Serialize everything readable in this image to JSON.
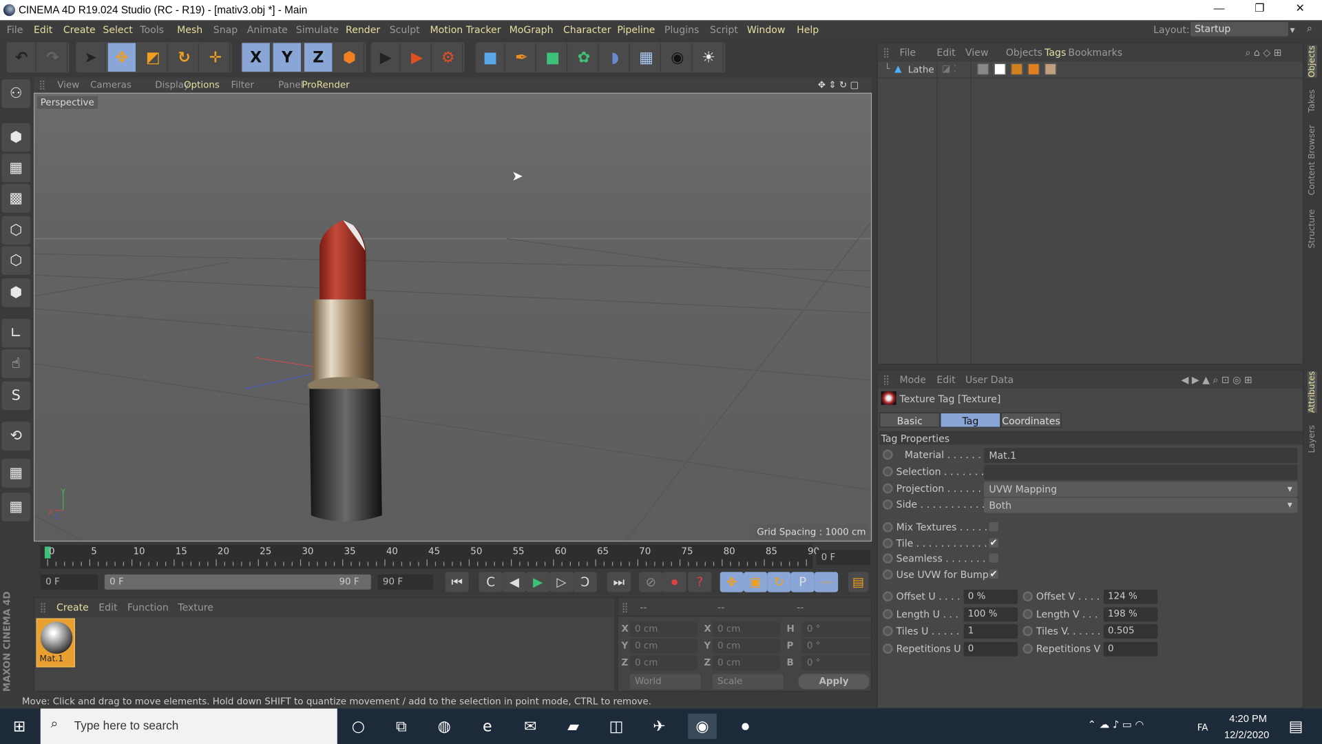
{
  "window": {
    "title": "CINEMA 4D R19.024 Studio (RC - R19) - [mativ3.obj *] - Main",
    "minimize": "—",
    "restore": "❐",
    "close": "✕"
  },
  "menubar": {
    "items": [
      {
        "label": "File",
        "style": "dim"
      },
      {
        "label": "Edit",
        "style": "hl"
      },
      {
        "label": "Create",
        "style": "hl"
      },
      {
        "label": "Select",
        "style": "hl"
      },
      {
        "label": "Tools",
        "style": "dim"
      },
      {
        "label": "Mesh",
        "style": "hl"
      },
      {
        "label": "Snap",
        "style": "dim"
      },
      {
        "label": "Animate",
        "style": "dim"
      },
      {
        "label": "Simulate",
        "style": "dim"
      },
      {
        "label": "Render",
        "style": "hl"
      },
      {
        "label": "Sculpt",
        "style": "dim"
      },
      {
        "label": "Motion Tracker",
        "style": "hl"
      },
      {
        "label": "MoGraph",
        "style": "hl"
      },
      {
        "label": "Character",
        "style": "hl"
      },
      {
        "label": "Pipeline",
        "style": "hl"
      },
      {
        "label": "Plugins",
        "style": "dim"
      },
      {
        "label": "Script",
        "style": "dim"
      },
      {
        "label": "Window",
        "style": "hl"
      },
      {
        "label": "Help",
        "style": "hl"
      }
    ],
    "layout_label": "Layout:",
    "layout_value": "Startup"
  },
  "toolbar": {
    "icons": [
      "undo-icon",
      "redo-icon",
      "live-selection-icon",
      "move-icon",
      "scale-icon",
      "rotate-icon",
      "last-tool-icon",
      "x-axis-icon",
      "y-axis-icon",
      "z-axis-icon",
      "coordinate-system-icon",
      "render-view-icon",
      "render-picture-viewer-icon",
      "render-settings-icon",
      "cube-icon",
      "pen-icon",
      "subdivision-icon",
      "cloner-icon",
      "bend-deformer-icon",
      "floor-icon",
      "camera-icon",
      "light-icon"
    ],
    "axis_labels": [
      "X",
      "Y",
      "Z"
    ]
  },
  "left_tools": [
    "make-editable-icon",
    "model-mode-icon",
    "texture-mode-icon",
    "workplane-mode-icon",
    "points-mode-icon",
    "edges-mode-icon",
    "polygons-mode-icon",
    "axis-mode-icon",
    "tweak-icon",
    "solo-icon",
    "snap-icon",
    "workplane-lock-icon",
    "workplane-rotate-icon"
  ],
  "viewport": {
    "menu": [
      {
        "label": "View",
        "style": "dim"
      },
      {
        "label": "Cameras",
        "style": "dim"
      },
      {
        "label": "Display",
        "style": "dim"
      },
      {
        "label": "Options",
        "style": "hl"
      },
      {
        "label": "Filter",
        "style": "dim"
      },
      {
        "label": "Panel",
        "style": "dim"
      },
      {
        "label": "ProRender",
        "style": "hl"
      }
    ],
    "camera_label": "Perspective",
    "grid_spacing": "Grid Spacing : 1000 cm",
    "axis": {
      "x": "X",
      "y": "Y",
      "z": "Z"
    }
  },
  "timeline": {
    "ticks": [
      "0",
      "5",
      "10",
      "15",
      "20",
      "25",
      "30",
      "35",
      "40",
      "45",
      "50",
      "55",
      "60",
      "65",
      "70",
      "75",
      "80",
      "85",
      "90"
    ],
    "current_frame": "0 F",
    "start_field": "0 F",
    "range_start": "0 F",
    "range_end": "90 F",
    "end_field": "90 F",
    "current_frame_value": 0,
    "max_frame": 90
  },
  "playback": {
    "buttons": [
      {
        "icon": "go-to-start-icon",
        "glyph": "⏮"
      },
      {
        "icon": "previous-key-icon",
        "glyph": "C"
      },
      {
        "icon": "previous-frame-icon",
        "glyph": "◀"
      },
      {
        "icon": "play-icon",
        "glyph": "▶"
      },
      {
        "icon": "next-frame-icon",
        "glyph": "▷"
      },
      {
        "icon": "next-key-icon",
        "glyph": "Ↄ"
      },
      {
        "icon": "go-to-end-icon",
        "glyph": "⏭"
      },
      {
        "icon": "record-disabled-icon",
        "glyph": "⊘"
      },
      {
        "icon": "record-keys-icon",
        "glyph": "⏺"
      },
      {
        "icon": "autokeying-icon",
        "glyph": "?"
      },
      {
        "icon": "key-position-icon",
        "glyph": "✥"
      },
      {
        "icon": "key-scale-icon",
        "glyph": "▣"
      },
      {
        "icon": "key-rotation-icon",
        "glyph": "↻"
      },
      {
        "icon": "key-parameter-icon",
        "glyph": "P"
      },
      {
        "icon": "key-point-level-icon",
        "glyph": "⋯"
      },
      {
        "icon": "timeline-window-icon",
        "glyph": "▤"
      }
    ]
  },
  "material_manager": {
    "menu": [
      {
        "label": "Create",
        "style": "hl"
      },
      {
        "label": "Edit",
        "style": "dim"
      },
      {
        "label": "Function",
        "style": "dim"
      },
      {
        "label": "Texture",
        "style": "dim"
      }
    ],
    "materials": [
      {
        "name": "Mat.1"
      }
    ]
  },
  "coordinates": {
    "headers": [
      "--",
      "--",
      "--"
    ],
    "rows": [
      {
        "a": "X",
        "av": "0 cm",
        "b": "X",
        "bv": "0 cm",
        "c": "H",
        "cv": "0 °"
      },
      {
        "a": "Y",
        "av": "0 cm",
        "b": "Y",
        "bv": "0 cm",
        "c": "P",
        "cv": "0 °"
      },
      {
        "a": "Z",
        "av": "0 cm",
        "b": "Z",
        "bv": "0 cm",
        "c": "B",
        "cv": "0 °"
      }
    ],
    "space": "World",
    "mode": "Scale",
    "apply": "Apply"
  },
  "status": "Move: Click and drag to move elements. Hold down SHIFT to quantize movement / add to the selection in point mode, CTRL to remove.",
  "objects_panel": {
    "menu": [
      {
        "label": "File",
        "style": "dim"
      },
      {
        "label": "Edit",
        "style": "dim"
      },
      {
        "label": "View",
        "style": "dim"
      },
      {
        "label": "Objects",
        "style": "dim"
      },
      {
        "label": "Tags",
        "style": "hl"
      },
      {
        "label": "Bookmarks",
        "style": "dim"
      }
    ],
    "objects": [
      {
        "name": "Lathe",
        "tags": [
          "unknown-tag-icon",
          "texture-tag-checker-icon",
          "pose-tag-icon",
          "phong-tag-icon",
          "material-tag-icon"
        ]
      }
    ]
  },
  "attributes": {
    "menu": [
      {
        "label": "Mode",
        "style": "dim"
      },
      {
        "label": "Edit",
        "style": "dim"
      },
      {
        "label": "User Data",
        "style": "dim"
      }
    ],
    "title": "Texture Tag [Texture]",
    "tabs": [
      {
        "label": "Basic",
        "active": false
      },
      {
        "label": "Tag",
        "active": true
      },
      {
        "label": "Coordinates",
        "active": false
      }
    ],
    "section": "Tag Properties",
    "material": {
      "label": "Material . . . . . . .",
      "value": "Mat.1"
    },
    "selection": {
      "label": "Selection . . . . . . . .",
      "value": ""
    },
    "projection": {
      "label": "Projection . . . . . . .",
      "value": "UVW Mapping"
    },
    "side": {
      "label": "Side . . . . . . . . . . . .",
      "value": "Both"
    },
    "checks": [
      {
        "label": "Mix Textures . . . . .",
        "checked": false
      },
      {
        "label": "Tile . . . . . . . . . . . . .",
        "checked": true
      },
      {
        "label": "Seamless . . . . . . . .",
        "checked": false
      },
      {
        "label": "Use UVW for Bump",
        "checked": true
      }
    ],
    "pairs": [
      {
        "l1": "Offset U . . . .",
        "v1": "0 %",
        "l2": "Offset V . . . .",
        "v2": "124 %"
      },
      {
        "l1": "Length U . . .",
        "v1": "100 %",
        "l2": "Length V . . .",
        "v2": "198 %"
      },
      {
        "l1": "Tiles U . . . . .",
        "v1": "1",
        "l2": "Tiles V. . . . . .",
        "v2": "0.505"
      },
      {
        "l1": "Repetitions U",
        "v1": "0",
        "l2": "Repetitions V",
        "v2": "0"
      }
    ]
  },
  "right_tabs": [
    "Objects",
    "Takes",
    "Content Browser",
    "Structure",
    "Attributes",
    "Layers"
  ],
  "brand": "MAXON CINEMA 4D",
  "taskbar": {
    "search_placeholder": "Type here to search",
    "apps": [
      "cortana-icon",
      "task-view-icon",
      "firefox-icon",
      "edge-icon",
      "mail-icon",
      "file-explorer-icon",
      "store-icon",
      "telegram-icon",
      "cinema4d-icon",
      "screen-recorder-icon"
    ],
    "time": "4:20 PM",
    "date": "12/2/2020",
    "language": "FA"
  },
  "colors": {
    "accent": "#8aa6d6",
    "highlight_text": "#e6dfa0",
    "keyframe": "#3ec27a"
  }
}
